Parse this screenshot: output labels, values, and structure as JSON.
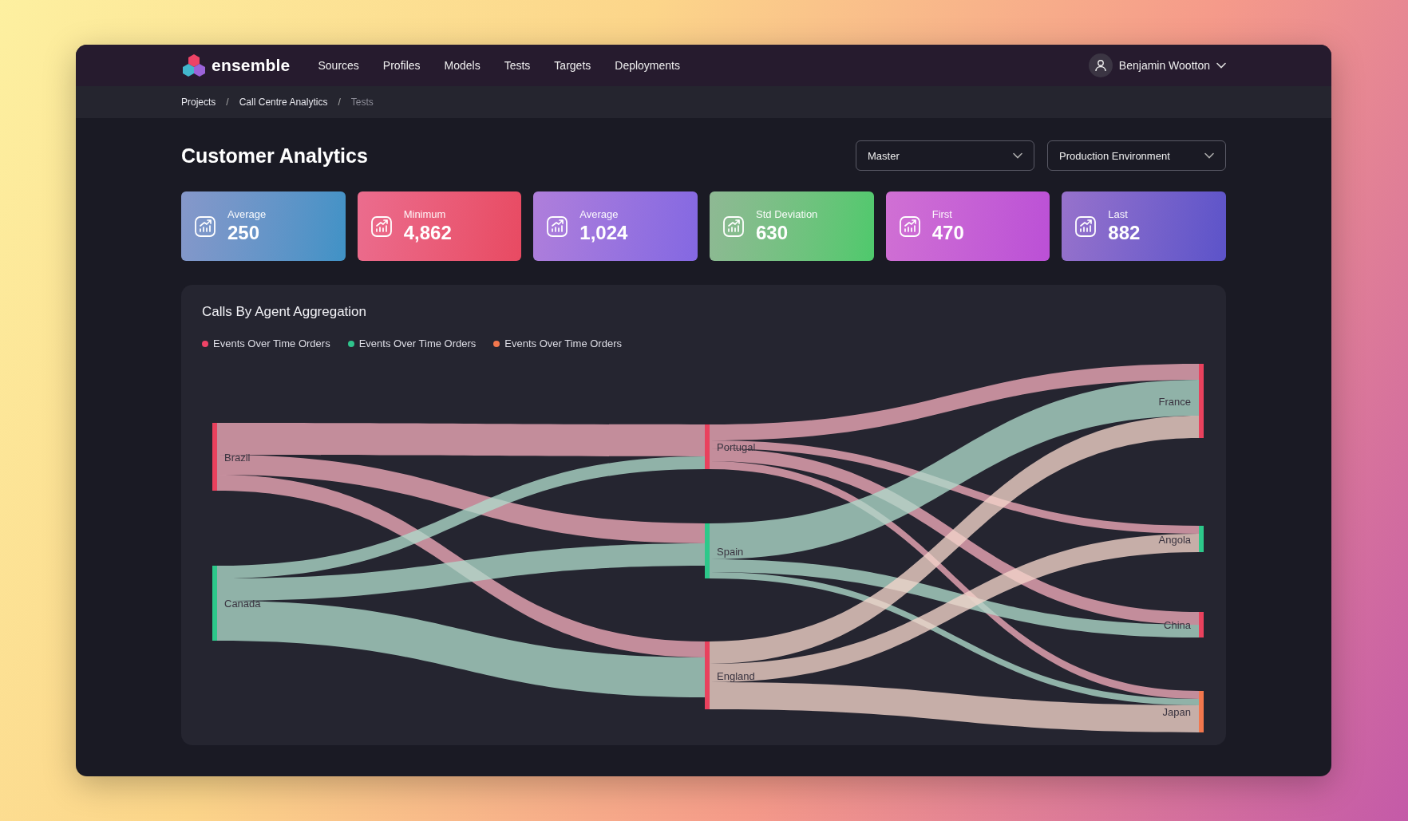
{
  "nav": {
    "brand": "ensemble",
    "links": [
      {
        "label": "Sources"
      },
      {
        "label": "Profiles"
      },
      {
        "label": "Models"
      },
      {
        "label": "Tests"
      },
      {
        "label": "Targets"
      },
      {
        "label": "Deployments"
      }
    ],
    "user": "Benjamin Wootton"
  },
  "breadcrumb": {
    "items": [
      {
        "label": "Projects",
        "current": false
      },
      {
        "label": "Call Centre Analytics",
        "current": false
      },
      {
        "label": "Tests",
        "current": true
      }
    ],
    "separators": [
      "/",
      "/"
    ]
  },
  "page": {
    "title": "Customer Analytics",
    "selects": [
      {
        "value": "Master"
      },
      {
        "value": "Production Environment"
      }
    ]
  },
  "stats": [
    {
      "label": "Average",
      "value": "250",
      "color": "#3f92c6"
    },
    {
      "label": "Minimum",
      "value": "4,862",
      "color": "#e84a62"
    },
    {
      "label": "Average",
      "value": "1,024",
      "color": "#8468e2"
    },
    {
      "label": "Std Deviation",
      "value": "630",
      "color": "#4ec96c"
    },
    {
      "label": "First",
      "value": "470",
      "color": "#bb50d6"
    },
    {
      "label": "Last",
      "value": "882",
      "color": "#5c53c9"
    }
  ],
  "chart": {
    "title": "Calls By Agent Aggregation",
    "legend": [
      {
        "label": "Events Over Time Orders",
        "color": "#ee4366"
      },
      {
        "label": "Events Over Time Orders",
        "color": "#2fc48c"
      },
      {
        "label": "Events Over Time Orders",
        "color": "#f2774d"
      }
    ],
    "nodes": [
      {
        "label": "Brazil",
        "color": "#e9415d"
      },
      {
        "label": "Canada",
        "color": "#2dc88a"
      },
      {
        "label": "Portugal",
        "color": "#e9415d"
      },
      {
        "label": "Spain",
        "color": "#2dc88a"
      },
      {
        "label": "England",
        "color": "#e9415d"
      },
      {
        "label": "France",
        "color": "#e9415d"
      },
      {
        "label": "Angola",
        "color": "#2dc88a"
      },
      {
        "label": "China",
        "color": "#e9415d"
      },
      {
        "label": "Japan",
        "color": "#f2774d"
      }
    ]
  }
}
